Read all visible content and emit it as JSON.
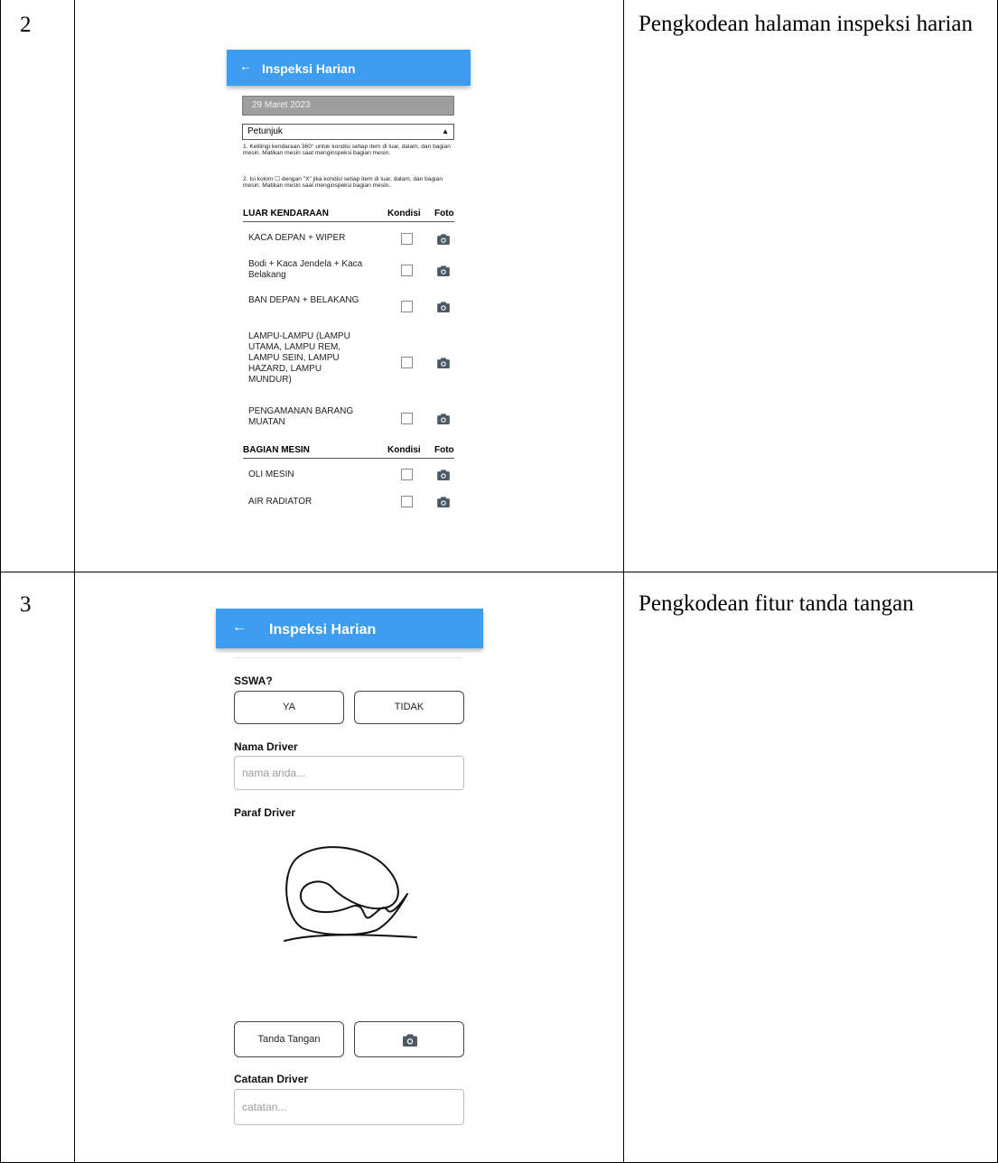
{
  "table": {
    "rows": [
      {
        "number": "2",
        "description": "Pengkodean halaman inspeksi harian",
        "screen": {
          "appbar": {
            "back_icon": "arrow-left-icon",
            "title": "Inspeksi Harian"
          },
          "date": "29 Maret 2023",
          "dropdown": {
            "selected": "Petunjuk",
            "icon": "caret-up-icon"
          },
          "instructions": [
            "1. Kelilingi kendaraan 360° untuk kondisi setiap item di luar, dalam, dan bagian mesin. Matikan mesin saat menginspeksi bagian mesin.",
            "2. Isi kolom ☐ dengan \"X\" jika kondisi setiap item di luar, dalam, dan bagian mesin. Matikan mesin saat menginspeksi bagian mesin.."
          ],
          "sections": [
            {
              "title": "LUAR KENDARAAN",
              "col_kondisi": "Kondisi",
              "col_foto": "Foto",
              "items": [
                {
                  "label": "KACA DEPAN + WIPER",
                  "checked": false
                },
                {
                  "label": "Bodi + Kaca Jendela + Kaca Belakang",
                  "checked": false
                },
                {
                  "label": "BAN DEPAN + BELAKANG",
                  "checked": false
                },
                {
                  "label": "LAMPU-LAMPU (LAMPU UTAMA, LAMPU REM, LAMPU SEIN, LAMPU HAZARD, LAMPU MUNDUR)",
                  "checked": false
                },
                {
                  "label": "PENGAMANAN BARANG MUATAN",
                  "checked": false
                }
              ]
            },
            {
              "title": "BAGIAN MESIN",
              "col_kondisi": "Kondisi",
              "col_foto": "Foto",
              "items": [
                {
                  "label": "OLI MESIN",
                  "checked": false
                },
                {
                  "label": "AIR RADIATOR",
                  "checked": false
                }
              ]
            }
          ]
        }
      },
      {
        "number": "3",
        "description": "Pengkodean fitur tanda tangan",
        "screen": {
          "appbar": {
            "back_icon": "arrow-left-icon",
            "title": "Inspeksi Harian"
          },
          "sswa": {
            "label": "SSWA?",
            "yes": "YA",
            "no": "TIDAK"
          },
          "driver_name": {
            "label": "Nama Driver",
            "placeholder": "nama anda..."
          },
          "signature": {
            "label": "Paraf Driver"
          },
          "sign_button": "Tanda Tangan",
          "camera_icon": "camera-icon",
          "notes": {
            "label": "Catatan Driver",
            "placeholder": "catatan..."
          }
        }
      }
    ]
  },
  "colors": {
    "appbar": "#3d9df0",
    "datebar": "#9e9e9e",
    "icon": "#4a5a66"
  }
}
